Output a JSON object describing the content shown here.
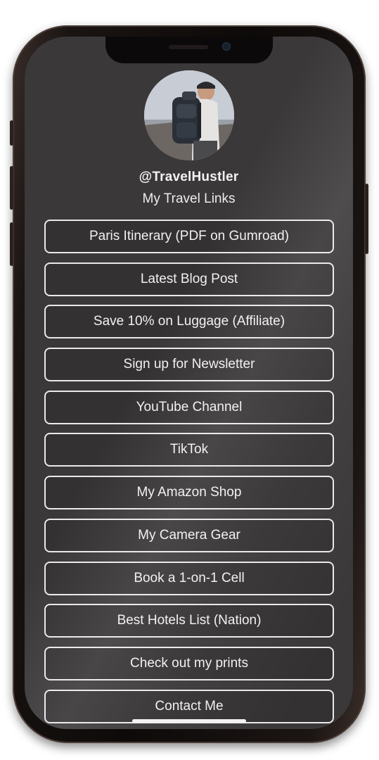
{
  "profile": {
    "handle": "@TravelHustler",
    "subtitle": "My Travel Links"
  },
  "links": [
    {
      "label": "Paris Itinerary (PDF on Gumroad)"
    },
    {
      "label": "Latest Blog Post"
    },
    {
      "label": "Save 10% on Luggage (Affiliate)"
    },
    {
      "label": "Sign up for Newsletter"
    },
    {
      "label": "YouTube Channel"
    },
    {
      "label": "TikTok"
    },
    {
      "label": "My Amazon Shop"
    },
    {
      "label": "My Camera Gear"
    },
    {
      "label": "Book a 1-on-1 Cell"
    },
    {
      "label": "Best Hotels List (Nation)"
    },
    {
      "label": "Check out my prints"
    },
    {
      "label": "Contact Me"
    }
  ],
  "colors": {
    "screen_background": "#3b383a",
    "button_border": "#e9e9e9",
    "text": "#f1f1f1"
  }
}
